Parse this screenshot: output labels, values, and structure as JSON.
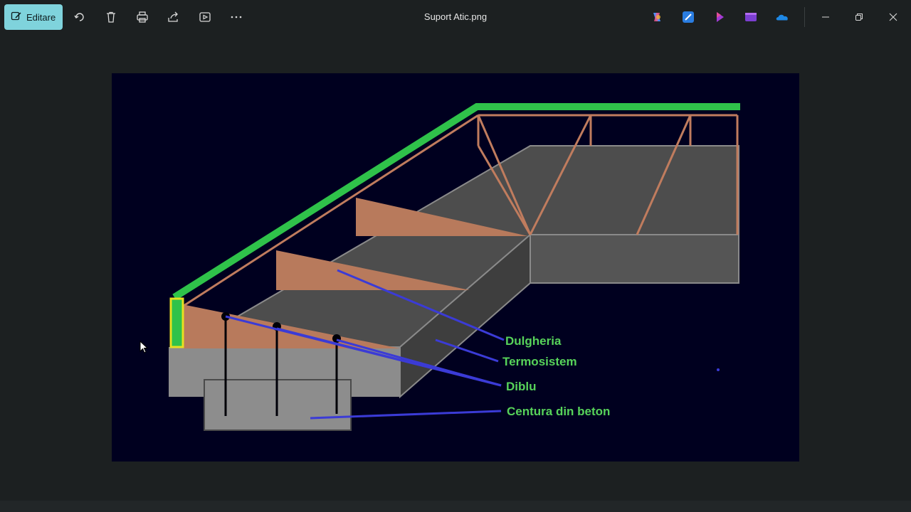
{
  "toolbar": {
    "edit_label": "Editare",
    "icons": [
      "edit-icon",
      "rotate-icon",
      "delete-icon",
      "print-icon",
      "share-icon",
      "slideshow-icon",
      "more-icon"
    ]
  },
  "window": {
    "title": "Suport Atic.png",
    "apps": [
      "copilot-icon",
      "designer-icon",
      "clipchamp-purple-icon",
      "clipchamp-icon",
      "onedrive-icon"
    ],
    "controls": [
      "minimize-icon",
      "restore-icon",
      "close-icon"
    ]
  },
  "diagram": {
    "labels": {
      "dulgheria": "Dulgheria",
      "termosistem": "Termosistem",
      "diblu": "Diblu",
      "centura": "Centura din beton"
    },
    "colors": {
      "background": "#00001f",
      "green": "#2fc24a",
      "wood": "#b87a5c",
      "grey": "#5a5a5a",
      "leader": "#3b3bd6",
      "yellow": "#e8e020"
    }
  }
}
